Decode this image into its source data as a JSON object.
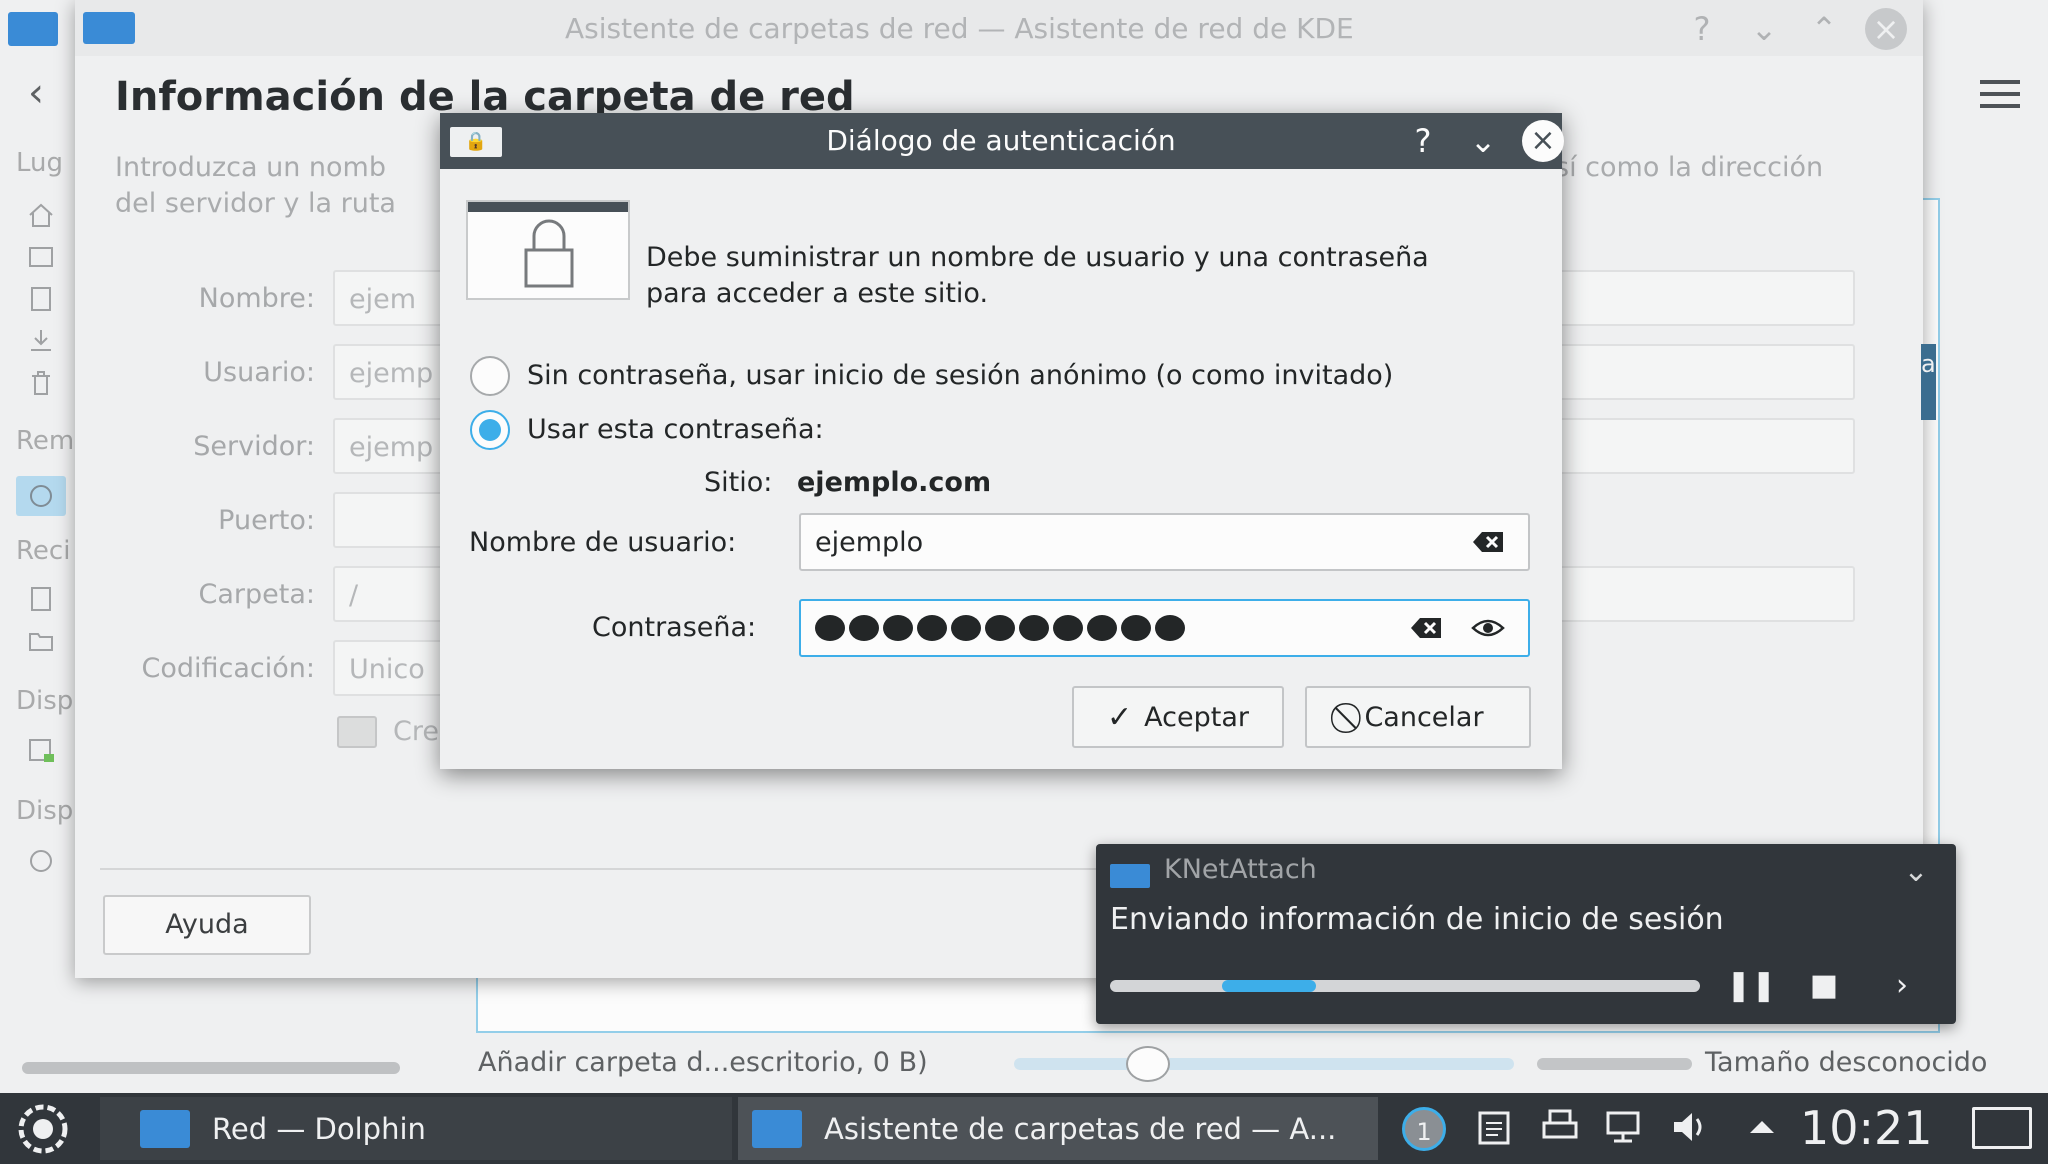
{
  "dolphin": {
    "places_labels": [
      "Lug",
      "Rem",
      "Reci",
      "Disp",
      "Disp"
    ],
    "status_text": "Añadir carpeta d...escritorio, 0 B)",
    "status_size": "Tamaño desconocido"
  },
  "wizard": {
    "title": "Asistente de carpetas de red — Asistente de red de KDE",
    "heading": "Información de la carpeta de red",
    "intro_left": "Introduzca un nomb",
    "intro_left2": "del servidor y la ruta",
    "intro_right": "sí como la dirección",
    "fields": [
      {
        "label": "Nombre:",
        "value": "ejem"
      },
      {
        "label": "Usuario:",
        "value": "ejemp"
      },
      {
        "label": "Servidor:",
        "value": "ejemp"
      },
      {
        "label": "Puerto:",
        "value": ""
      },
      {
        "label": "Carpeta:",
        "value": "/"
      },
      {
        "label": "Codificación:",
        "value": "Unico"
      }
    ],
    "checkbox_label": "Cre",
    "help_button": "Ayuda",
    "right_fragment": "a"
  },
  "auth": {
    "title": "Diálogo de autenticación",
    "message": "Debe suministrar un nombre de usuario y una contraseña para acceder a este sitio.",
    "radio_anonymous": "Sin contraseña, usar inicio de sesión anónimo (o como invitado)",
    "radio_password": "Usar esta contraseña:",
    "site_label": "Sitio:",
    "site_value": "ejemplo.com",
    "username_label": "Nombre de usuario:",
    "username_value": "ejemplo",
    "password_label": "Contraseña:",
    "password_length": 11,
    "ok_button": "Aceptar",
    "cancel_button": "Cancelar"
  },
  "notification": {
    "app": "KNetAttach",
    "body": "Enviando información de inicio de sesión",
    "progress_fraction": 0.16
  },
  "taskbar": {
    "tasks": [
      {
        "label": "Red — Dolphin"
      },
      {
        "label": "Asistente de carpetas de red — A..."
      }
    ],
    "notification_count": "1",
    "clock": "10:21"
  },
  "colors": {
    "accent": "#3daee9",
    "titlebar_active": "#475057",
    "taskbar": "#31363b"
  }
}
